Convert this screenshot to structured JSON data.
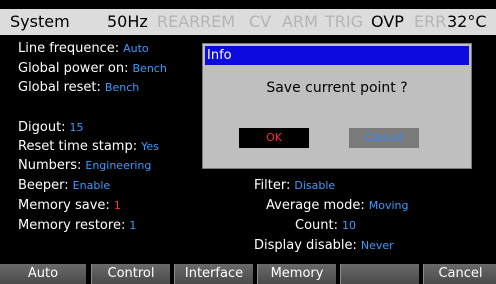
{
  "status_bar": {
    "title": "System",
    "indicators": [
      "50Hz",
      "REAR",
      "REM",
      "CV",
      "ARM",
      "TRIG",
      "OVP",
      "ERR",
      "32°C"
    ]
  },
  "settings": {
    "line_frequence": {
      "label": "Line frequence:",
      "value": "Auto"
    },
    "global_power_on": {
      "label": "Global power on:",
      "value": "Bench"
    },
    "global_reset": {
      "label": "Global reset:",
      "value": "Bench"
    },
    "digout": {
      "label": "Digout:",
      "value": "15"
    },
    "reset_time_stamp": {
      "label": "Reset time stamp:",
      "value": "Yes"
    },
    "numbers": {
      "label": "Numbers:",
      "value": "Engineering"
    },
    "beeper": {
      "label": "Beeper:",
      "value": "Enable"
    },
    "memory_save": {
      "label": "Memory save:",
      "value": "1"
    },
    "memory_restore": {
      "label": "Memory restore:",
      "value": "1"
    },
    "filter": {
      "label": "Filter:",
      "value": "Disable"
    },
    "average_mode": {
      "label": "Average mode:",
      "value": "Moving"
    },
    "count": {
      "label": "Count:",
      "value": "10"
    },
    "display_disable": {
      "label": "Display disable:",
      "value": "Never"
    }
  },
  "dialog": {
    "title": "Info",
    "message": "Save current point ?",
    "ok_label": "OK",
    "cancel_label": "Cancel"
  },
  "softkeys": [
    "Auto",
    "Control",
    "Interface",
    "Memory",
    "",
    "Cancel"
  ],
  "colors": {
    "value_blue": "#3d9bff",
    "value_red": "#ff3030",
    "dialog_title_bg": "#0b0be0",
    "dialog_bg": "#bfbfbf",
    "status_active": "#000000",
    "status_dim": "#b4b4b4"
  }
}
